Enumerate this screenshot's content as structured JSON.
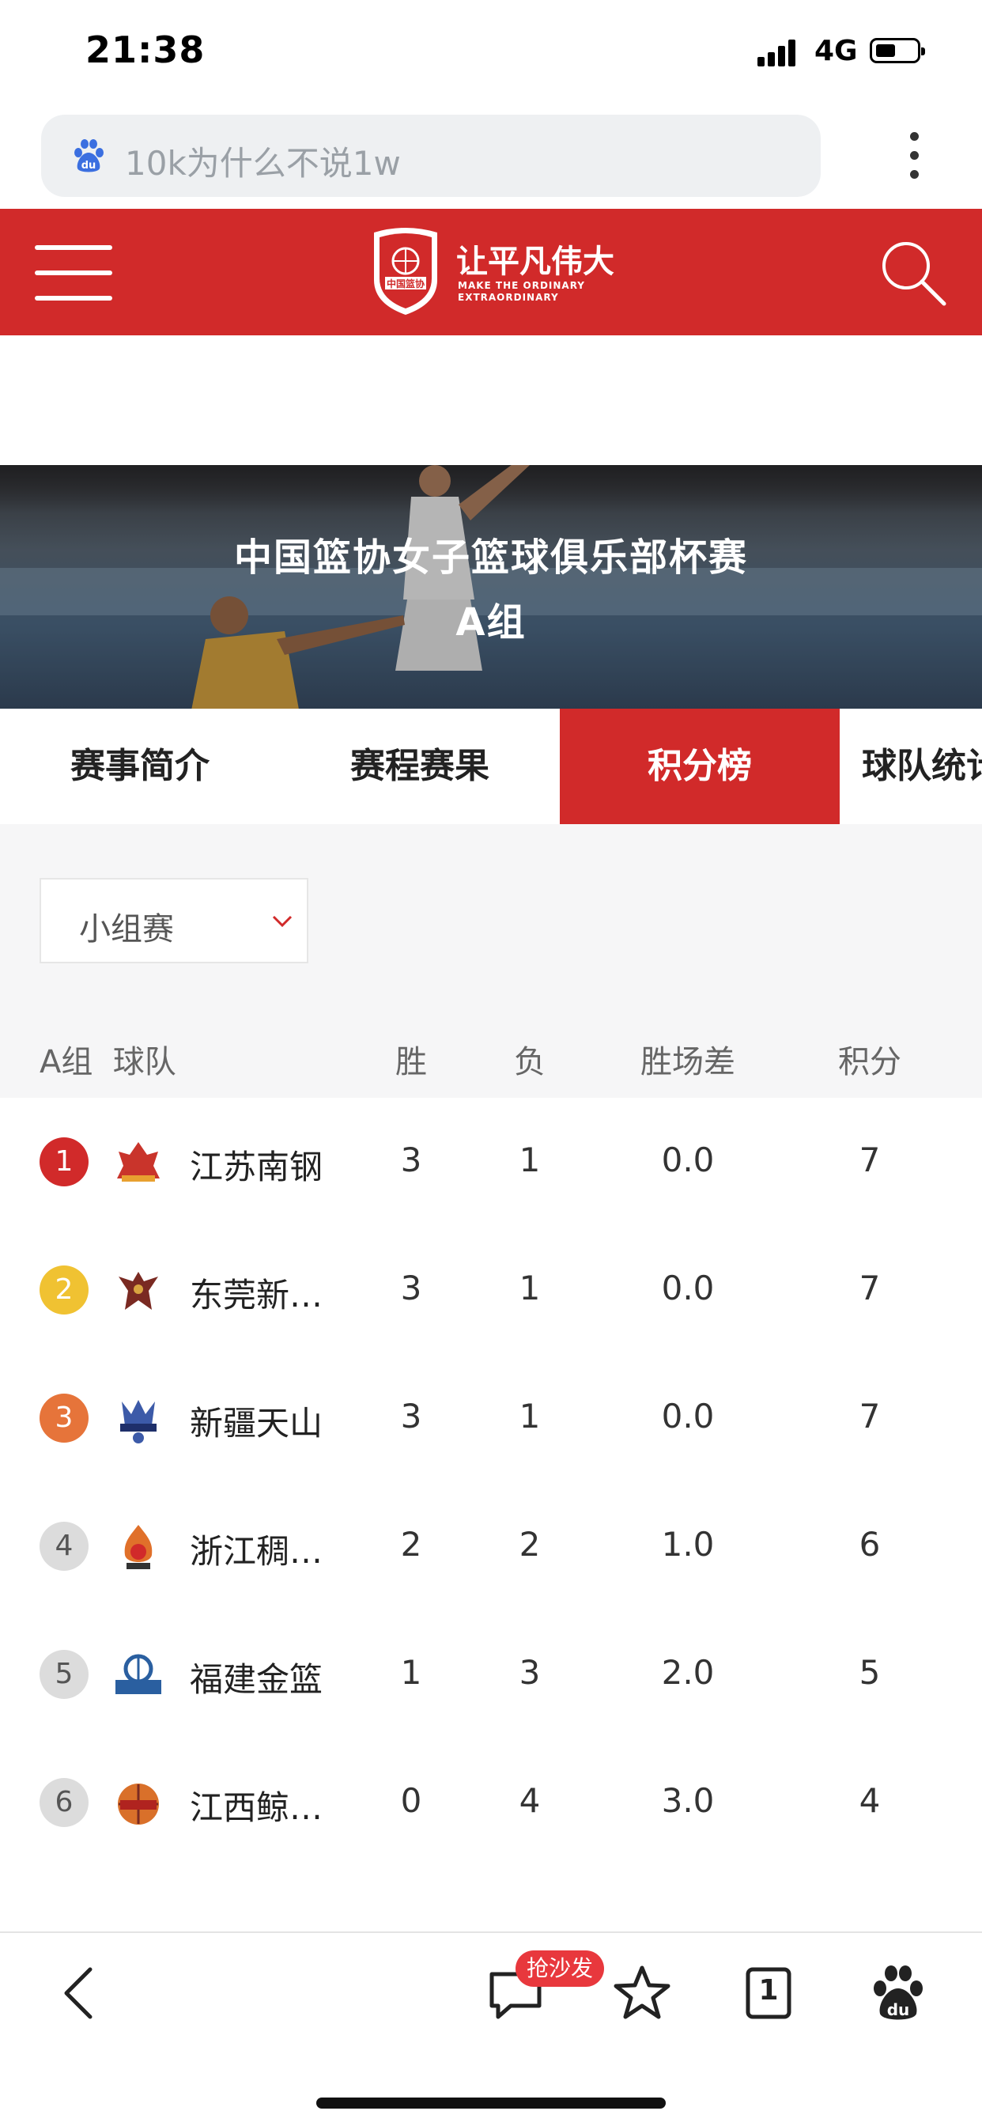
{
  "status_bar": {
    "time": "21:38",
    "network": "4G"
  },
  "browser": {
    "search_query": "10k为什么不说1w",
    "search_icon": "baidu-paw-icon",
    "more_icon": "kebab-icon"
  },
  "header": {
    "brand_color": "#d12a2a",
    "logo_badge": "中国篮协",
    "logo_slogan": "让平凡伟大",
    "logo_subline_1": "MAKE THE ORDINARY",
    "logo_subline_2": "EXTRAORDINARY"
  },
  "banner": {
    "title_line1": "中国篮协女子篮球俱乐部杯赛",
    "title_line2": "A组"
  },
  "tabs": [
    {
      "label": "赛事简介",
      "active": false
    },
    {
      "label": "赛程赛果",
      "active": false
    },
    {
      "label": "积分榜",
      "active": true
    },
    {
      "label": "球队统计",
      "active": false
    }
  ],
  "filter": {
    "selected": "小组赛"
  },
  "table": {
    "headers": {
      "group_team": "A组  球队",
      "wins": "胜",
      "losses": "负",
      "diff": "胜场差",
      "points": "积分"
    },
    "rows": [
      {
        "rank": "1",
        "rank_color": "#d12a2a",
        "team": "江苏南钢",
        "wins": "3",
        "losses": "1",
        "diff": "0.0",
        "points": "7"
      },
      {
        "rank": "2",
        "rank_color": "#f0c232",
        "team": "东莞新…",
        "wins": "3",
        "losses": "1",
        "diff": "0.0",
        "points": "7"
      },
      {
        "rank": "3",
        "rank_color": "#e6743a",
        "team": "新疆天山",
        "wins": "3",
        "losses": "1",
        "diff": "0.0",
        "points": "7"
      },
      {
        "rank": "4",
        "rank_color": "#dcdcdc",
        "team": "浙江稠…",
        "wins": "2",
        "losses": "2",
        "diff": "1.0",
        "points": "6"
      },
      {
        "rank": "5",
        "rank_color": "#dcdcdc",
        "team": "福建金篮",
        "wins": "1",
        "losses": "3",
        "diff": "2.0",
        "points": "5"
      },
      {
        "rank": "6",
        "rank_color": "#dcdcdc",
        "team": "江西鲸…",
        "wins": "0",
        "losses": "4",
        "diff": "3.0",
        "points": "4"
      }
    ]
  },
  "bottom_nav": {
    "comment_badge": "抢沙发",
    "tab_count": "1"
  }
}
